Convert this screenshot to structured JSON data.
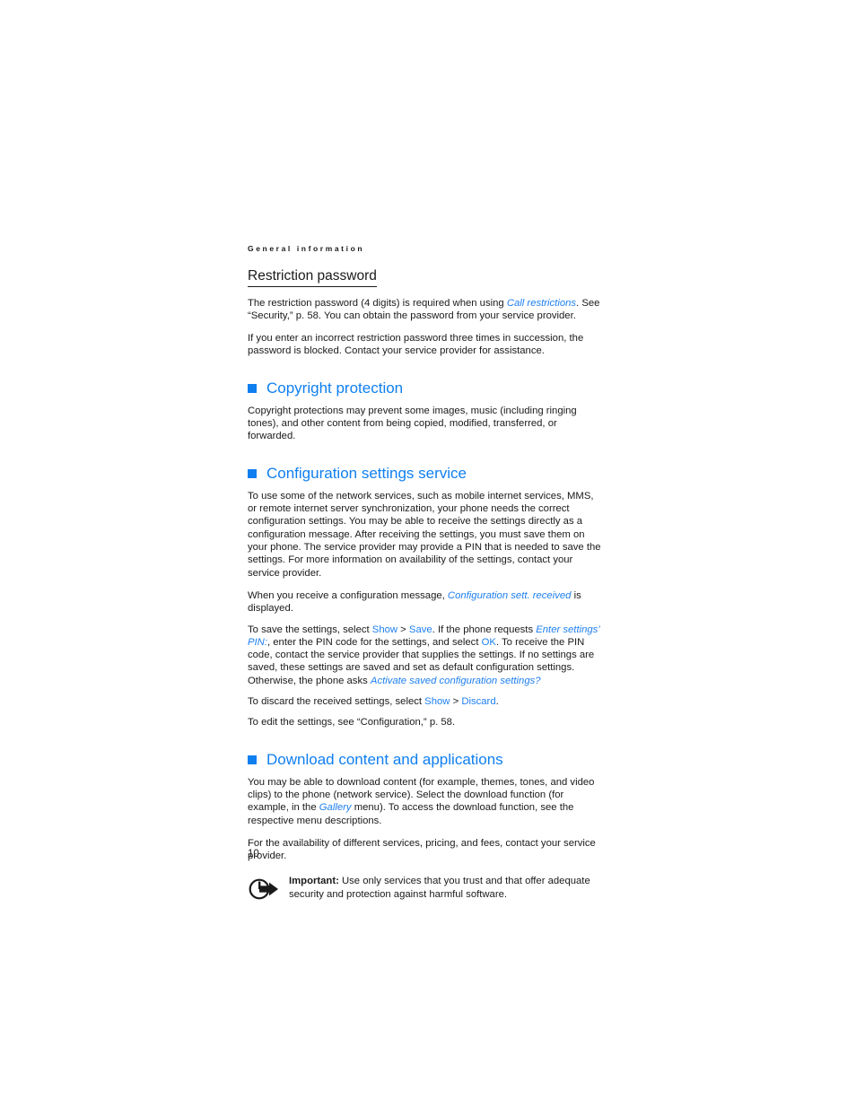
{
  "document": {
    "running_head": "General information",
    "page_number": "10"
  },
  "sections": [
    {
      "heading": "Restriction password",
      "heading_style": "underlined-black",
      "paragraphs": [
        {
          "runs": [
            {
              "text": "The restriction password (4 digits) is required when using ",
              "style": "normal"
            },
            {
              "text": "Call restrictions",
              "style": "link-italic"
            },
            {
              "text": ". See “Security,” p. 58. You can obtain the password from your service provider.",
              "style": "normal"
            }
          ]
        },
        {
          "runs": [
            {
              "text": "If you enter an incorrect restriction password three times in succession, the password is blocked. Contact your service provider for assistance.",
              "style": "normal"
            }
          ]
        }
      ]
    },
    {
      "heading": "Copyright protection",
      "heading_style": "blue-square-bullet",
      "bullet_icon": "blue-square-bullet-icon",
      "paragraphs": [
        {
          "runs": [
            {
              "text": "Copyright protections may prevent some images, music (including ringing tones), and other content from being copied, modified, transferred, or forwarded.",
              "style": "normal"
            }
          ]
        }
      ]
    },
    {
      "heading": "Configuration settings service",
      "heading_style": "blue-square-bullet",
      "bullet_icon": "blue-square-bullet-icon",
      "paragraphs": [
        {
          "runs": [
            {
              "text": "To use some of the network services, such as mobile internet services, MMS, or remote internet server synchronization, your phone needs the correct configuration settings. You may be able to receive the settings directly as a configuration message. After receiving the settings, you must save them on your phone. The service provider may provide a PIN that is needed to save the settings. For more information on availability of the settings, contact your service provider.",
              "style": "normal"
            }
          ]
        },
        {
          "runs": [
            {
              "text": "When you receive a configuration message, ",
              "style": "normal"
            },
            {
              "text": "Configuration sett. received",
              "style": "link-italic"
            },
            {
              "text": " is displayed.",
              "style": "normal"
            }
          ]
        },
        {
          "runs": [
            {
              "text": "To save the settings, select ",
              "style": "normal"
            },
            {
              "text": "Show",
              "style": "link"
            },
            {
              "text": " > ",
              "style": "normal"
            },
            {
              "text": "Save",
              "style": "link"
            },
            {
              "text": ". If the phone requests ",
              "style": "normal"
            },
            {
              "text": "Enter settings’ PIN:",
              "style": "link-italic"
            },
            {
              "text": ", enter the PIN code for the settings, and select ",
              "style": "normal"
            },
            {
              "text": "OK",
              "style": "link"
            },
            {
              "text": ". To receive the PIN code, contact the service provider that supplies the settings. If no settings are saved, these settings are saved and set as default configuration settings. Otherwise, the phone asks ",
              "style": "normal"
            },
            {
              "text": "Activate saved configuration settings?",
              "style": "link-italic"
            }
          ]
        },
        {
          "runs": [
            {
              "text": "To discard the received settings, select ",
              "style": "normal"
            },
            {
              "text": "Show",
              "style": "link"
            },
            {
              "text": " > ",
              "style": "normal"
            },
            {
              "text": "Discard",
              "style": "link"
            },
            {
              "text": ".",
              "style": "normal"
            }
          ]
        },
        {
          "runs": [
            {
              "text": "To edit the settings, see “Configuration,” p. 58.",
              "style": "normal"
            }
          ]
        }
      ]
    },
    {
      "heading": "Download content and applications",
      "heading_style": "blue-square-bullet",
      "bullet_icon": "blue-square-bullet-icon",
      "paragraphs": [
        {
          "runs": [
            {
              "text": "You may be able to download content (for example, themes, tones, and video clips) to the phone (network service). Select the download function (for example, in the ",
              "style": "normal"
            },
            {
              "text": "Gallery",
              "style": "link-italic"
            },
            {
              "text": " menu). To access the download function, see the respective menu descriptions.",
              "style": "normal"
            }
          ]
        },
        {
          "runs": [
            {
              "text": "For the availability of different services, pricing, and fees, contact your service provider.",
              "style": "normal"
            }
          ]
        }
      ],
      "note": {
        "icon": "important-arrow-circle-icon",
        "label": "Important:",
        "text": " Use only services that you trust and that offer adequate security and protection against harmful software."
      }
    }
  ],
  "colors": {
    "accent_blue": "#0f7ff0",
    "link_blue": "#1d7ff0",
    "text_black": "#1a1a1a",
    "page_background": "#ffffff"
  }
}
